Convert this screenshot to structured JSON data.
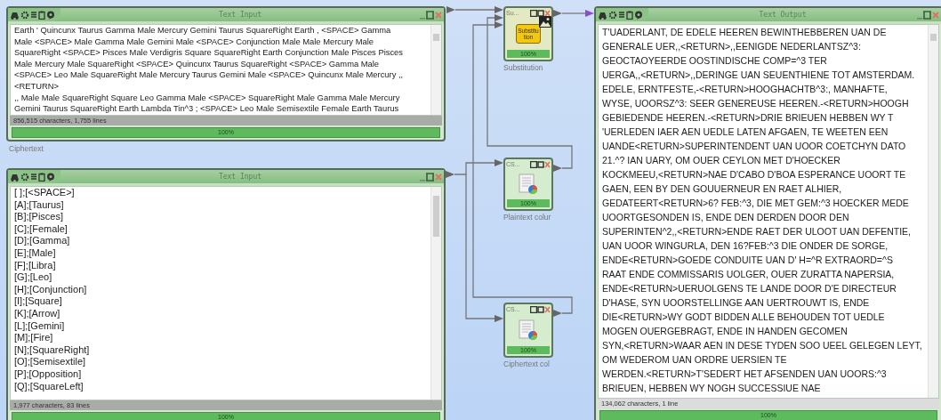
{
  "windows": [
    {
      "kind": "input",
      "title": "Text Input",
      "lines": [
        "Earth ' Quincunx Taurus Gamma Male Mercury Gemini Taurus SquareRight Earth , <SPACE> Gamma",
        "Male <SPACE> Male Gamma Male Gemini Male <SPACE> Conjunction Male Male Mercury Male",
        "SquareRight <SPACE> Pisces Male Verdigris Square SquareRight Earth Conjunction Male Pisces Pisces",
        "Male Mercury Male SquareRight <SPACE> Quincunx Taurus SquareRight <SPACE> Gamma Male",
        "<SPACE> Leo Male SquareRight Male Mercury Taurus Gemini Male <SPACE> Quincunx Male Mercury ,,",
        "<RETURN>",
        ",, Male Male SquareRight Square Leo Gamma Male <SPACE> SquareRight Male Gamma Male Mercury",
        "Gemini Taurus SquareRight Earth Lambda Tin^3 ; <SPACE> Leo Male Semisextile Female Earth Taurus"
      ],
      "status": "856,515 characters, 1,755 lines",
      "progress": "100%",
      "level": 1,
      "caption": "Ciphertext"
    },
    {
      "kind": "input",
      "title": "Text Input",
      "lines": [
        "[ ];[<SPACE>]",
        "[A];[Taurus]",
        "[B];[Pisces]",
        "[C];[Female]",
        "[D];[Gamma]",
        "[E];[Male]",
        "[F];[Libra]",
        "[G];[Leo]",
        "[H];[Conjunction]",
        "[I];[Square]",
        "[K];[Arrow]",
        "[L];[Gemini]",
        "[M];[Fire]",
        "[N];[SquareRight]",
        "[O];[Semisextile]",
        "[P];[Opposition]",
        "[Q];[SquareLeft]"
      ],
      "status": "1,977 characters, 83 lines",
      "progress": "100%",
      "level": 1
    },
    {
      "kind": "output",
      "title": "Text Output",
      "lines": [
        "T'UADERLANT, DE EDELE HEEREN BEWINTHEBBEREN UAN DE",
        "GENERALE UER,,<RETURN>,,EENIGDE NEDERLANTSZ^3:",
        "GEOCTAOYEERDE OOSTINDISCHE COMP=^3 TER",
        "UERGA,,<RETURN>,,DERINGE UAN SEUENTHIENE TOT AMSTERDAM.",
        "EDELE, ERNTFESTE,-<RETURN>HOOGHACHTB^3:, MANHAFTE,",
        "WYSE, UOORSZ^3: SEER GENEREUSE HEEREN.-<RETURN>HOOGH",
        "GEBIEDENDE HEEREN.-<RETURN>DRIE BRIEUEN HEBBEN WY T",
        "'UERLEDEN IAER AEN UEDLE LATEN AFGAEN, TE WEETEN EEN",
        "UANDE<RETURN>SUPERINTENDENT UAN UOOR COETCHYN DATO",
        "21.^? IAN UARY, OM OUER CEYLON MET D'HOECKER",
        "KOCKMEEU,<RETURN>NAE D'CABO D'BOA ESPERANCE UOORT TE",
        "GAEN, EEN BY DEN GOUUERNEUR EN RAET ALHIER,",
        "GEDATEERT<RETURN>6? FEB:^3, DIE MET GEM:^3 HOECKER MEDE",
        "UOORTGESONDEN IS, ENDE DEN DERDEN DOOR DEN",
        "SUPERINTEN^2,,<RETURN>ENDE RAET DER ULOOT UAN DEFENTIE,",
        "UAN UOOR WINGURLA, DEN 16?FEB:^3 DIE ONDER DE SORGE,",
        "ENDE<RETURN>GOEDE CONDUITE UAN D' H=^R EXTRAORD=^S",
        "RAAT ENDE COMMISSARIS UOLGER, OUER ZURATTA NAPERSIA,",
        "ENDE<RETURN>UERUOLGENS TE LANDE DOOR D'E DIRECTEUR",
        "D'HASE, SYN UOORSTELLINGE AAN UERTROUWT IS, ENDE",
        "DIE<RETURN>WY GODT BIDDEN ALLE BEHOUDEN TOT UEDLE",
        "MOGEN OUERGEBRAGT, ENDE IN HANDEN GECOMEN",
        "SYN,<RETURN>WAAR AEN IN DESE TYDEN SOO UEEL GELEGEN LEYT,",
        "OM WEDEROM UAN ORDRE UERSIEN TE",
        "WERDEN.<RETURN>T'SEDERT HET AFSENDEN UAN UOORS:^3",
        "BRIEUEN, HEBBEN WY NOGH SUCCESSIUE NAE"
      ],
      "status": "134,062 characters, 1 line",
      "progress": "100%",
      "level": 1
    }
  ],
  "nodes": [
    {
      "kind": "substitution",
      "title": "Su...",
      "icon_text": "Substitution",
      "progress": "100%",
      "level": 1,
      "caption": "Substitution"
    },
    {
      "kind": "csv",
      "title": "CS...",
      "progress": "100%",
      "level": 1,
      "caption": "Plaintext colur"
    },
    {
      "kind": "csv",
      "title": "CS...",
      "progress": "100%",
      "level": 1,
      "caption": "Ciphertext col"
    }
  ]
}
